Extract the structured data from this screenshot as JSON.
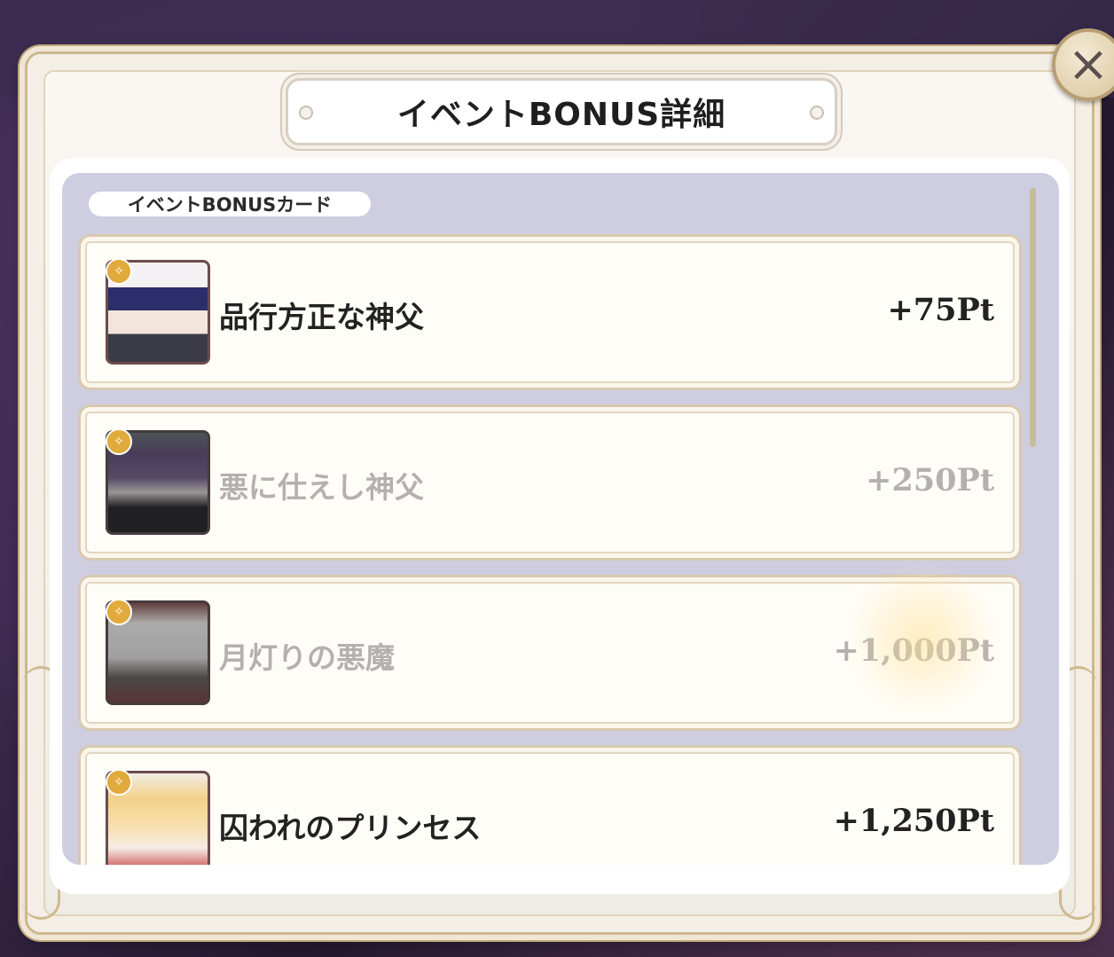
{
  "dialog": {
    "title": "イベントBONUS詳細",
    "close_label": "×"
  },
  "section": {
    "label": "イベントBONUSカード"
  },
  "cards": [
    {
      "name": "品行方正な神父",
      "points": "+75Pt",
      "owned": true
    },
    {
      "name": "悪に仕えし神父",
      "points": "+250Pt",
      "owned": false
    },
    {
      "name": "月灯りの悪魔",
      "points": "+1,000Pt",
      "owned": false
    },
    {
      "name": "囚われのプリンセス",
      "points": "+1,250Pt",
      "owned": true
    }
  ],
  "colors": {
    "list_background": "#cfcde0",
    "frame_gold": "#cdb791",
    "badge": "#e1aa3c",
    "dim_text": "#b5b0b0"
  },
  "icons": {
    "close": "close-icon",
    "badge": "rarity-badge-icon"
  }
}
